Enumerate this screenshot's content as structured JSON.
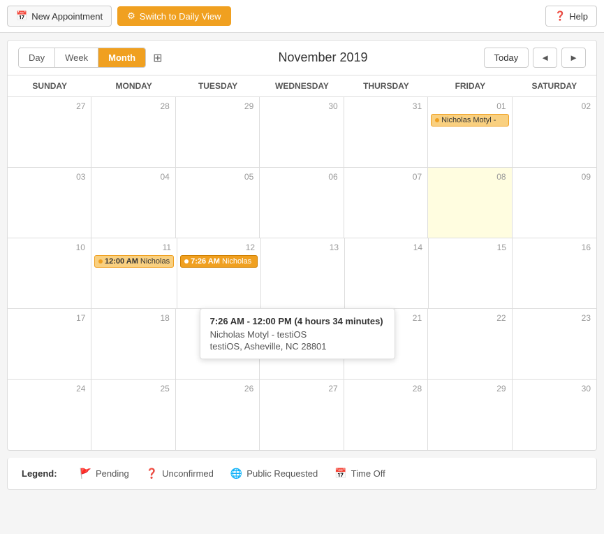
{
  "topbar": {
    "new_appointment_label": "New Appointment",
    "switch_view_label": "Switch to Daily View",
    "help_label": "Help"
  },
  "calendar": {
    "view_buttons": [
      "Day",
      "Week",
      "Month"
    ],
    "active_view": "Month",
    "title": "November 2019",
    "today_label": "Today",
    "prev_label": "◄",
    "next_label": "►"
  },
  "day_headers": [
    "Sunday",
    "Monday",
    "Tuesday",
    "Wednesday",
    "Thursday",
    "Friday",
    "Saturday"
  ],
  "weeks": [
    {
      "days": [
        {
          "num": "27",
          "events": []
        },
        {
          "num": "28",
          "events": []
        },
        {
          "num": "29",
          "events": []
        },
        {
          "num": "30",
          "events": []
        },
        {
          "num": "31",
          "events": []
        },
        {
          "num": "01",
          "today": false,
          "events": [
            {
              "label": "Nicholas Motyl -",
              "type": "orange"
            }
          ]
        },
        {
          "num": "02",
          "events": []
        }
      ]
    },
    {
      "days": [
        {
          "num": "03",
          "events": []
        },
        {
          "num": "04",
          "events": []
        },
        {
          "num": "05",
          "events": []
        },
        {
          "num": "06",
          "events": []
        },
        {
          "num": "07",
          "events": []
        },
        {
          "num": "08",
          "today": true,
          "events": []
        },
        {
          "num": "09",
          "events": []
        }
      ]
    },
    {
      "days": [
        {
          "num": "10",
          "events": []
        },
        {
          "num": "11",
          "events": [
            {
              "label": "12:00 AM Nicholas",
              "type": "orange",
              "time": "12:00 AM"
            }
          ]
        },
        {
          "num": "12",
          "tooltip": true,
          "events": [
            {
              "label": "7:26 AM Nicholas",
              "type": "orange",
              "time": "7:26 AM"
            }
          ]
        },
        {
          "num": "13",
          "events": []
        },
        {
          "num": "14",
          "events": []
        },
        {
          "num": "15",
          "events": []
        },
        {
          "num": "16",
          "events": []
        }
      ]
    },
    {
      "days": [
        {
          "num": "17",
          "events": []
        },
        {
          "num": "18",
          "events": []
        },
        {
          "num": "19",
          "events": []
        },
        {
          "num": "20",
          "events": []
        },
        {
          "num": "21",
          "events": []
        },
        {
          "num": "22",
          "events": []
        },
        {
          "num": "23",
          "events": []
        }
      ]
    },
    {
      "days": [
        {
          "num": "24",
          "events": []
        },
        {
          "num": "25",
          "events": []
        },
        {
          "num": "26",
          "events": []
        },
        {
          "num": "27",
          "events": []
        },
        {
          "num": "28",
          "events": []
        },
        {
          "num": "29",
          "events": []
        },
        {
          "num": "30",
          "events": []
        }
      ]
    }
  ],
  "tooltip": {
    "time_range": "7:26 AM - 12:00 PM (4 hours 34 minutes)",
    "name": "Nicholas Motyl - testiOS",
    "location": "testiOS, Asheville, NC 28801"
  },
  "legend": {
    "title": "Legend:",
    "items": [
      {
        "icon": "🚩",
        "label": "Pending"
      },
      {
        "icon": "❓",
        "label": "Unconfirmed"
      },
      {
        "icon": "🌐",
        "label": "Public Requested"
      },
      {
        "icon": "📅",
        "label": "Time Off"
      }
    ]
  }
}
